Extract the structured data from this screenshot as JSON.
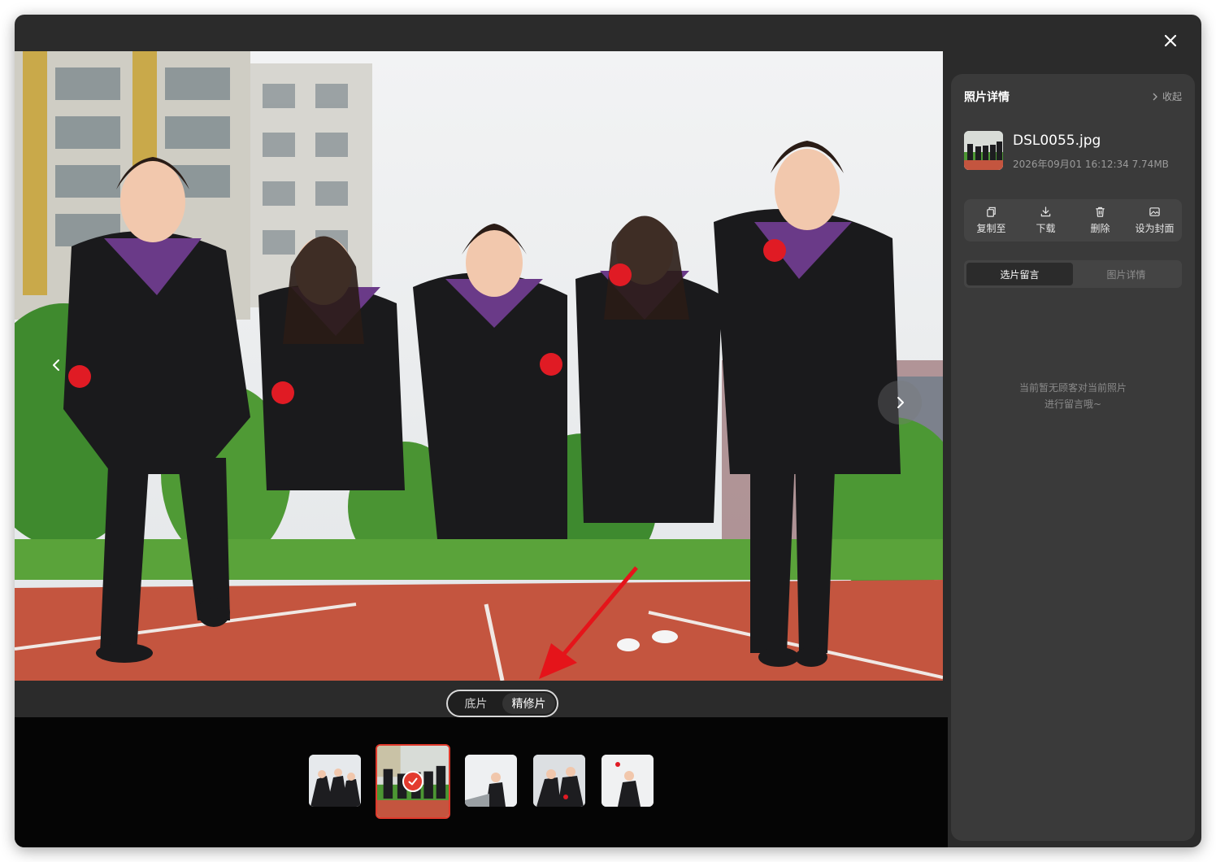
{
  "panel": {
    "title": "照片详情",
    "collapse_label": "收起",
    "file_name": "DSL0055.jpg",
    "file_meta": "2026年09月01 16:12:34  7.74MB",
    "actions": [
      {
        "label": "复制至",
        "icon": "copy-icon"
      },
      {
        "label": "下载",
        "icon": "download-icon"
      },
      {
        "label": "删除",
        "icon": "trash-icon"
      },
      {
        "label": "设为封面",
        "icon": "image-cover-icon"
      }
    ],
    "tabs": [
      {
        "label": "选片留言",
        "active": true
      },
      {
        "label": "图片详情",
        "active": false
      }
    ],
    "empty_line1": "当前暂无顾客对当前照片",
    "empty_line2": "进行留言哦~"
  },
  "toggle": {
    "options": [
      {
        "label": "底片",
        "active": false
      },
      {
        "label": "精修片",
        "active": true
      }
    ]
  },
  "thumbnails": {
    "count": 5,
    "selected_index": 1
  },
  "colors": {
    "accent": "#e33b2e",
    "window_bg": "#2b2b2b",
    "panel_bg": "#3a3a3a",
    "strip_bg": "#050505"
  }
}
